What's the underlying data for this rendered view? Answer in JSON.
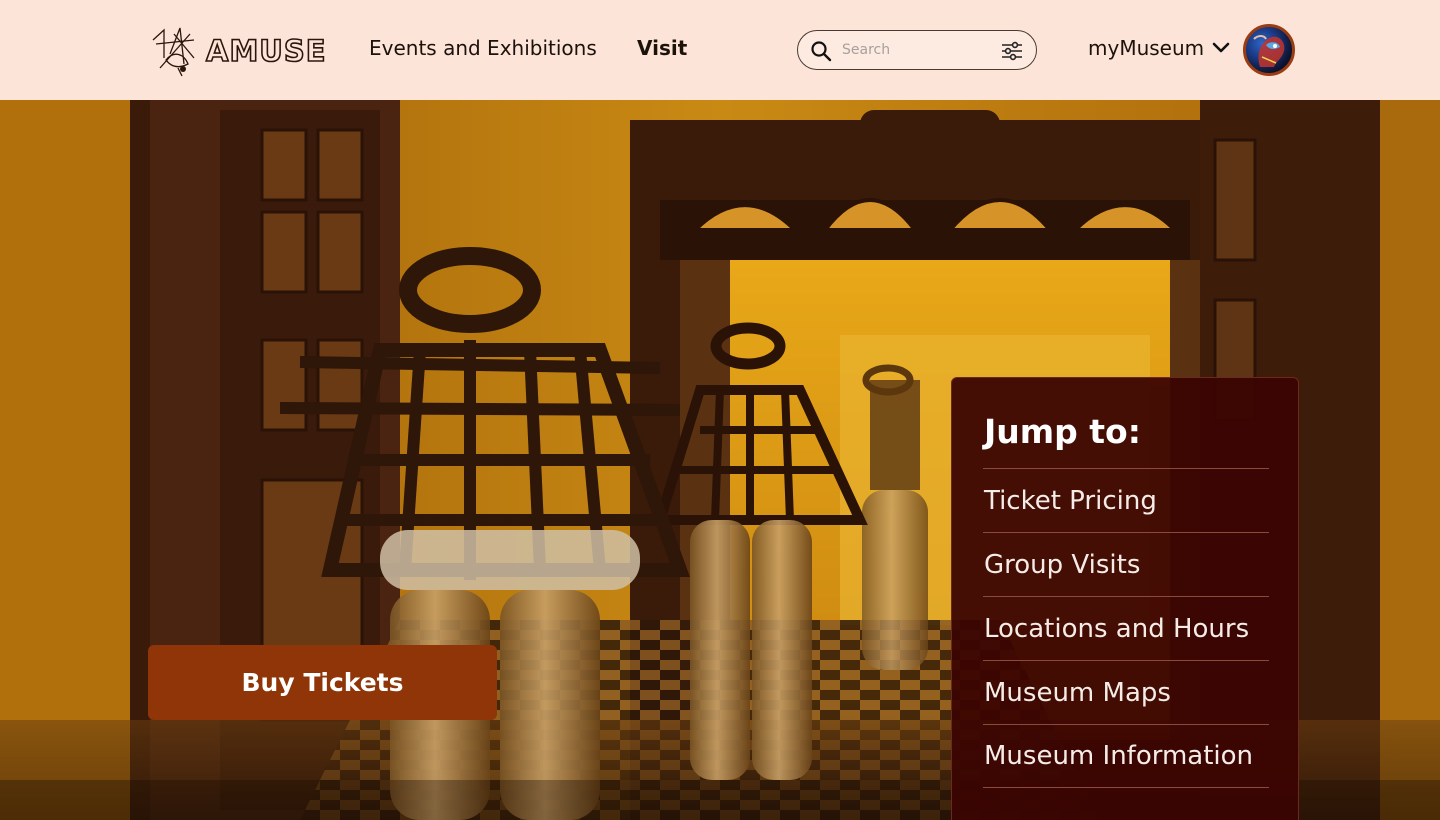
{
  "header": {
    "logo_text": "AMUSE",
    "nav": {
      "events_label": "Events and Exhibitions",
      "visit_label": "Visit"
    },
    "search": {
      "placeholder": "Search",
      "icon": "search-icon",
      "filter_icon": "sliders-icon"
    },
    "account": {
      "label": "myMuseum",
      "dropdown_icon": "chevron-down-icon"
    }
  },
  "hero": {
    "buy_button_label": "Buy Tickets"
  },
  "jump_panel": {
    "title": "Jump to:",
    "items": [
      {
        "label": "Ticket Pricing"
      },
      {
        "label": "Group Visits"
      },
      {
        "label": "Locations and Hours"
      },
      {
        "label": "Museum Maps"
      },
      {
        "label": "Museum Information"
      }
    ]
  },
  "colors": {
    "header_bg": "#fde4d8",
    "accent": "#8f3508",
    "panel_bg": "#3a0402"
  }
}
